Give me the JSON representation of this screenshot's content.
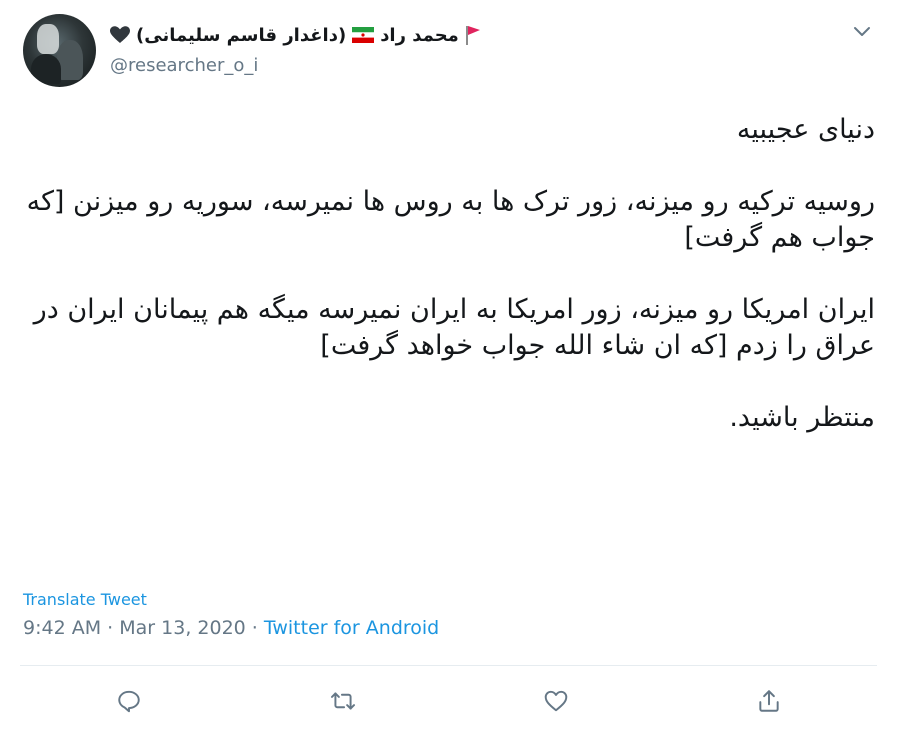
{
  "tweet": {
    "user": {
      "display_name_core": "محمد راد",
      "display_name_suffix": "(داغدار قاسم سلیمانی)",
      "handle": "@researcher_o_i",
      "avatar_icon": "avatar-photo"
    },
    "menu_icon": "chevron-down-icon",
    "text_lines": {
      "p1": "دنیای عجیبیه",
      "p2": "روسیه ترکیه رو میزنه، زور ترک ها به روس ها نمیرسه، سوریه رو میزنن [که جواب هم گرفت]",
      "p3": "ایران امریکا رو میزنه، زور امریکا به ایران نمیرسه میگه هم پیمانان ایران در عراق را زدم [که ان شاء الله جواب خواهد گرفت]",
      "p4": "منتظر باشید."
    },
    "translate_label": "Translate Tweet",
    "time": "9:42 AM",
    "date": "Mar 13, 2020",
    "separator": "·",
    "source": "Twitter for Android"
  },
  "actions": {
    "reply_icon": "reply-icon",
    "retweet_icon": "retweet-icon",
    "like_icon": "heart-outline-icon",
    "share_icon": "share-icon"
  },
  "colors": {
    "text": "#14171a",
    "secondary": "#657786",
    "link": "#1b95e0",
    "divider": "#e6ecf0"
  }
}
